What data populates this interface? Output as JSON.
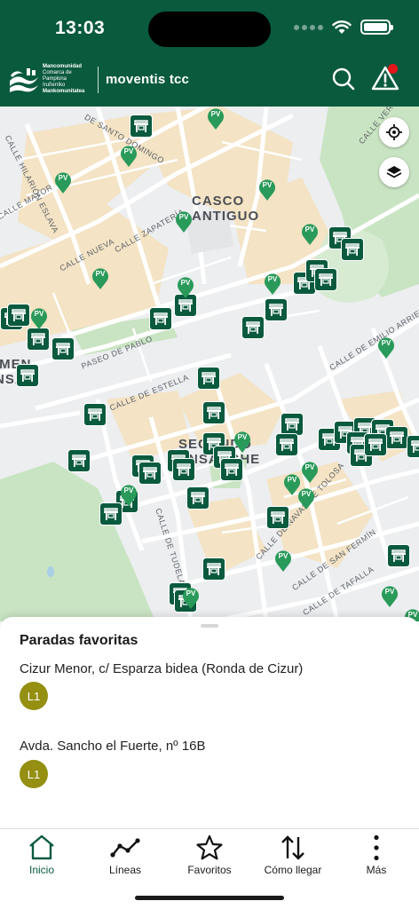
{
  "status_bar": {
    "time": "13:03"
  },
  "header": {
    "logo_text": [
      "Mancomunidad",
      "Comarca de Pamplona",
      "Iruñerriko",
      "Mankomunitatea"
    ],
    "brand": "moventis tcc",
    "brand_color": "#0a5a3e",
    "alert_dot_color": "#e5161b"
  },
  "map": {
    "districts": [
      {
        "text": "CASCO\nANTIGUO"
      },
      {
        "text": "SEGUNDO\nENSANCHE"
      },
      {
        "text": "IMEN\nNSAN"
      }
    ],
    "streets": [
      "CALLE HILARIÓN ESLAVA",
      "CALLE NUEVA",
      "CALLE ZAPATERÍA",
      "CALLE MAYOR",
      "DE SANTO DOMINGO",
      "PASEO DE PABLO",
      "CALLE DE ESTELLA",
      "CALLE DE TUDELA",
      "CALLE DE NAVAS DE TOLOSA",
      "CALLE DE EMILIO ARRIETA",
      "CALLE DE SAN FERMÍN",
      "CALLE DE TAFALLA",
      "CALLE VERGEL"
    ],
    "pv_label": "PV"
  },
  "favorites": {
    "title": "Paradas favoritas",
    "items": [
      {
        "name": "Cizur Menor,  c/ Esparza bidea (Ronda de Cizur)",
        "line": "L1"
      },
      {
        "name": "Avda. Sancho el Fuerte, nº 16B",
        "line": "L1"
      }
    ],
    "line_color": "#958f12"
  },
  "tabs": [
    {
      "label": "Inicio",
      "icon": "home-icon",
      "active": true
    },
    {
      "label": "Líneas",
      "icon": "route-icon",
      "active": false
    },
    {
      "label": "Favoritos",
      "icon": "star-icon",
      "active": false
    },
    {
      "label": "Cómo llegar",
      "icon": "arrows-updown-icon",
      "active": false
    },
    {
      "label": "Más",
      "icon": "more-vertical-icon",
      "active": false
    }
  ]
}
